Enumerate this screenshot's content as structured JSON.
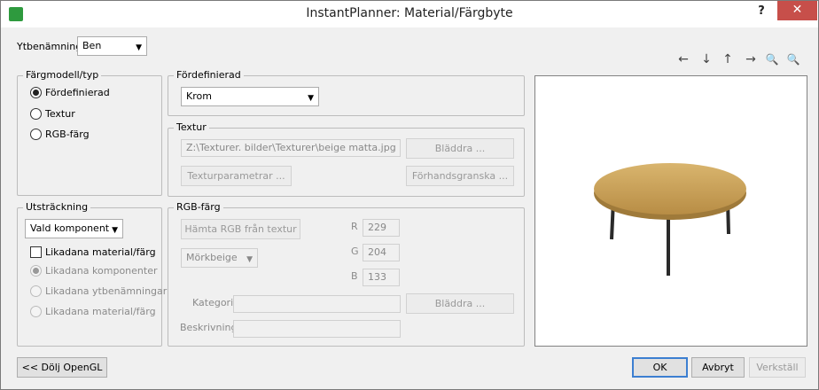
{
  "window": {
    "title": "InstantPlanner: Material/Färgbyte",
    "help_label": "?",
    "close_label": "✕"
  },
  "surface": {
    "label": "Ytbenämning",
    "value": "Ben"
  },
  "nav_icons": [
    "←",
    "↓",
    "↑",
    "→",
    "🔍",
    "🔍"
  ],
  "color_model": {
    "title": "Färgmodell/typ",
    "options": [
      "Fördefinierad",
      "Textur",
      "RGB-färg"
    ],
    "selected_index": 0
  },
  "extent": {
    "title": "Utsträckning",
    "scope_value": "Vald komponent",
    "checkbox_label": "Likadana material/färg",
    "options": [
      "Likadana komponenter",
      "Likadana ytbenämningar",
      "Likadana material/färg"
    ],
    "selected_index": 0
  },
  "predefined": {
    "title": "Fördefinierad",
    "value": "Krom"
  },
  "texture": {
    "title": "Textur",
    "path": "Z:\\Texturer. bilder\\Texturer\\beige matta.jpg",
    "browse_label": "Bläddra ...",
    "params_label": "Texturparametrar ...",
    "preview_label": "Förhandsgranska ..."
  },
  "rgb": {
    "title": "RGB-färg",
    "fetch_label": "Hämta RGB från textur",
    "color_name": "Mörkbeige",
    "r_label": "R",
    "r_value": "229",
    "g_label": "G",
    "g_value": "204",
    "b_label": "B",
    "b_value": "133",
    "category_label": "Kategori",
    "category_value": "",
    "browse_label": "Bläddra ...",
    "description_label": "Beskrivning",
    "description_value": ""
  },
  "buttons": {
    "hide_opengl": "<< Dölj OpenGL",
    "ok": "OK",
    "cancel": "Avbryt",
    "apply": "Verkställ"
  },
  "colors": {
    "tabletop": "#c9a15a",
    "legs": "#2a2a2a"
  }
}
